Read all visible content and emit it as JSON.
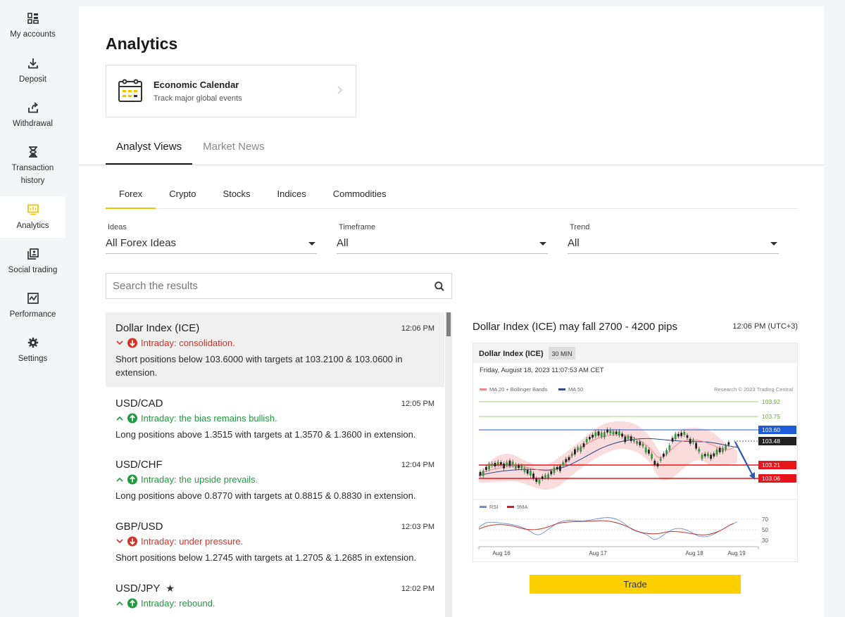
{
  "sidebar": {
    "items": [
      {
        "label": "My accounts",
        "icon": "accounts-icon"
      },
      {
        "label": "Deposit",
        "icon": "deposit-icon"
      },
      {
        "label": "Withdrawal",
        "icon": "withdrawal-icon"
      },
      {
        "label": "Transaction history",
        "icon": "hourglass-icon"
      },
      {
        "label": "Analytics",
        "icon": "analytics-icon",
        "active": true
      },
      {
        "label": "Social trading",
        "icon": "social-trading-icon"
      },
      {
        "label": "Performance",
        "icon": "performance-icon"
      },
      {
        "label": "Settings",
        "icon": "gear-icon"
      }
    ]
  },
  "page": {
    "title": "Analytics"
  },
  "econ_calendar": {
    "title": "Economic Calendar",
    "subtitle": "Track major global events"
  },
  "main_tabs": [
    "Analyst Views",
    "Market News"
  ],
  "sub_tabs": [
    "Forex",
    "Crypto",
    "Stocks",
    "Indices",
    "Commodities"
  ],
  "filters": {
    "ideas": {
      "label": "Ideas",
      "value": "All Forex Ideas"
    },
    "timeframe": {
      "label": "Timeframe",
      "value": "All"
    },
    "trend": {
      "label": "Trend",
      "value": "All"
    }
  },
  "search": {
    "placeholder": "Search the results"
  },
  "ideas": [
    {
      "pair": "Dollar Index (ICE)",
      "time": "12:06 PM",
      "direction": "down",
      "trend": "Intraday: consolidation.",
      "desc": "Short positions below 103.6000 with targets at 103.2100 & 103.0600 in extension."
    },
    {
      "pair": "USD/CAD",
      "time": "12:05 PM",
      "direction": "up",
      "trend": "Intraday: the bias remains bullish.",
      "desc": "Long positions above 1.3515 with targets at 1.3570 & 1.3600 in extension."
    },
    {
      "pair": "USD/CHF",
      "time": "12:04 PM",
      "direction": "up",
      "trend": "Intraday: the upside prevails.",
      "desc": "Long positions above 0.8770 with targets at 0.8815 & 0.8830 in extension."
    },
    {
      "pair": "GBP/USD",
      "time": "12:03 PM",
      "direction": "down",
      "trend": "Intraday: under pressure.",
      "desc": "Short positions below 1.2745 with targets at 1.2705 & 1.2685 in extension."
    },
    {
      "pair": "USD/JPY",
      "time": "12:02 PM",
      "direction": "up",
      "trend": "Intraday: rebound.",
      "desc": ""
    }
  ],
  "detail": {
    "title": "Dollar Index (ICE) may fall 2700 - 4200 pips",
    "time": "12:06 PM (UTC+3)",
    "trade_label": "Trade"
  },
  "chart": {
    "instrument": "Dollar Index (ICE)",
    "interval": "30 MIN",
    "datetime": "Friday, August 18, 2023 11:07:53 AM CET",
    "legend": [
      "MA 20 + Bollinger Bands",
      "MA 50"
    ],
    "credit": "Research © 2023 Trading Central",
    "levels": [
      {
        "label": "103.92",
        "kind": "target"
      },
      {
        "label": "103.75",
        "kind": "target"
      },
      {
        "label": "103.60",
        "kind": "pivot"
      },
      {
        "label": "103.48",
        "kind": "last"
      },
      {
        "label": "103.21",
        "kind": "support"
      },
      {
        "label": "103.06",
        "kind": "support"
      }
    ],
    "rsi_legend": [
      "RSI",
      "9MA"
    ],
    "rsi_levels": [
      "70",
      "50",
      "30"
    ],
    "x_labels": [
      "Aug 16",
      "Aug 17",
      "Aug 18",
      "Aug 19"
    ],
    "colors": {
      "blue": "#1e5bd6",
      "red": "#e8141b",
      "green": "#7cc04a",
      "black": "#222222"
    }
  }
}
